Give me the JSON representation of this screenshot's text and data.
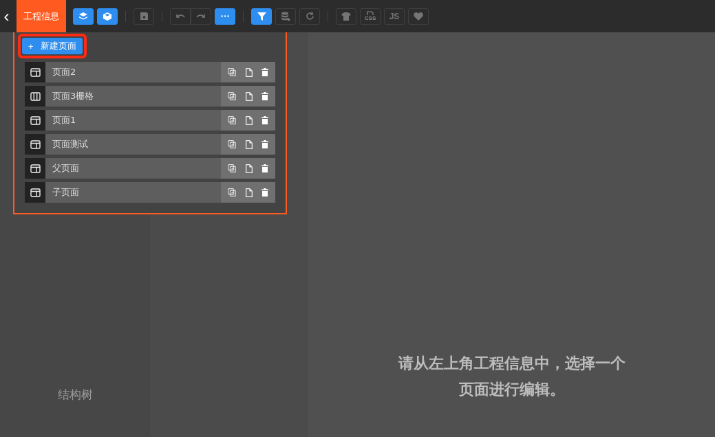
{
  "toolbar": {
    "back": "‹",
    "tab": {
      "label": "工程信息",
      "selected": true
    },
    "buttons": [
      {
        "kind": "layers",
        "active": true
      },
      {
        "kind": "box",
        "active": true
      },
      {
        "kind": "divider"
      },
      {
        "kind": "save",
        "active": false
      },
      {
        "kind": "divider"
      },
      {
        "kind": "undo",
        "active": false
      },
      {
        "kind": "redo",
        "active": false
      },
      {
        "kind": "more",
        "active": true
      },
      {
        "kind": "divider"
      },
      {
        "kind": "filter",
        "active": true
      },
      {
        "kind": "database",
        "active": false
      },
      {
        "kind": "refresh",
        "active": false
      },
      {
        "kind": "divider"
      },
      {
        "kind": "shirt",
        "active": false
      },
      {
        "kind": "css",
        "active": false,
        "label": "CSS"
      },
      {
        "kind": "text",
        "active": false,
        "label": "JS"
      },
      {
        "kind": "heart",
        "active": false
      }
    ]
  },
  "pages_panel": {
    "new_button": {
      "icon": "+",
      "label": "新建页面"
    },
    "pages": [
      {
        "name": "页面2",
        "kind": "single"
      },
      {
        "name": "页面3栅格",
        "kind": "columns"
      },
      {
        "name": "页面1",
        "kind": "single"
      },
      {
        "name": "页面测试",
        "kind": "single"
      },
      {
        "name": "父页面",
        "kind": "single"
      },
      {
        "name": "子页面",
        "kind": "single"
      }
    ]
  },
  "sidebar": {
    "label": "结构树"
  },
  "canvas": {
    "message_lines": [
      "请从左上角工程信息中，选择一个",
      "页面进行编辑。"
    ]
  }
}
